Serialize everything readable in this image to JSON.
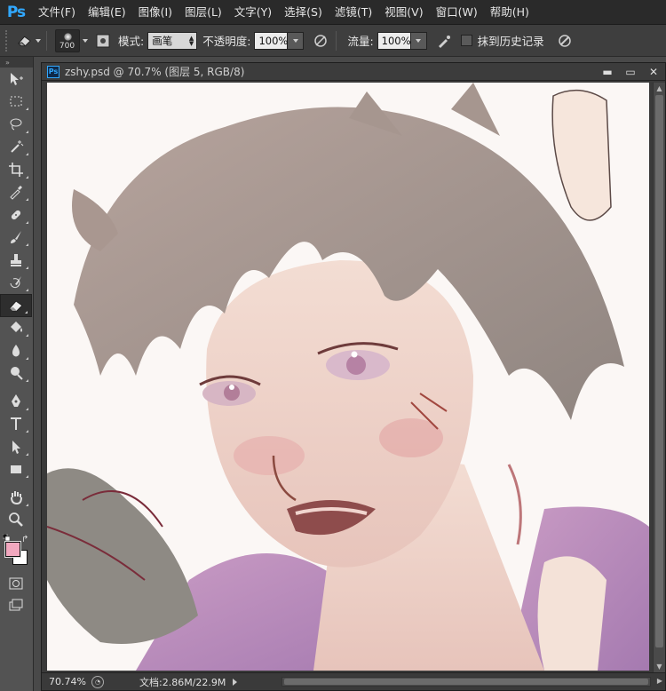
{
  "app": {
    "logo": "Ps",
    "menus": [
      "文件(F)",
      "编辑(E)",
      "图像(I)",
      "图层(L)",
      "文字(Y)",
      "选择(S)",
      "滤镜(T)",
      "视图(V)",
      "窗口(W)",
      "帮助(H)"
    ]
  },
  "options": {
    "brush_size": "700",
    "mode_label": "模式:",
    "mode_value": "画笔",
    "opacity_label": "不透明度:",
    "opacity_value": "100%",
    "flow_label": "流量:",
    "flow_value": "100%",
    "erase_history_label": "抹到历史记录",
    "erase_history_checked": false
  },
  "toolbar": {
    "tools": [
      "move-tool",
      "marquee-tool",
      "lasso-tool",
      "magic-wand-tool",
      "crop-tool",
      "eyedropper-tool",
      "healing-brush-tool",
      "brush-tool",
      "clone-stamp-tool",
      "history-brush-tool",
      "eraser-tool",
      "paint-bucket-tool",
      "blur-tool",
      "dodge-tool",
      "pen-tool",
      "type-tool",
      "path-selection-tool",
      "rectangle-tool",
      "hand-tool",
      "zoom-tool"
    ],
    "active_tool": "eraser-tool",
    "foreground_color": "#f2a8bf",
    "background_color": "#ffffff"
  },
  "document": {
    "title": "zshy.psd @ 70.7% (图层 5, RGB/8)",
    "zoom": "70.74%",
    "doc_info": "文档:2.86M/22.9M"
  }
}
